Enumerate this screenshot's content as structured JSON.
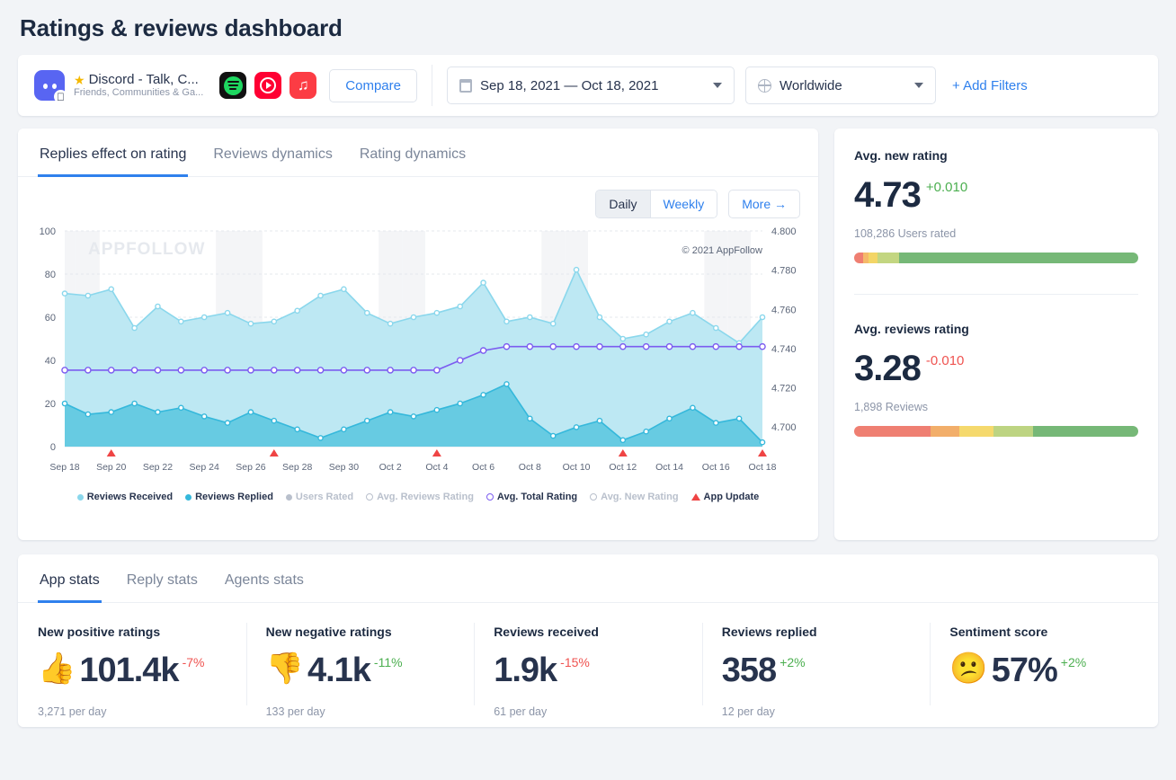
{
  "page_title": "Ratings & reviews dashboard",
  "header": {
    "app": {
      "name": "Discord - Talk, C...",
      "subtitle": "Friends, Communities & Ga...",
      "star_icon": "★",
      "platform_badge": "apple-icon"
    },
    "store_icons": [
      "spotify-icon",
      "youtube-music-icon",
      "apple-music-icon"
    ],
    "compare_label": "Compare",
    "date_range": "Sep 18, 2021 — Oct 18, 2021",
    "geo": "Worldwide",
    "add_filters_label": "+ Add Filters"
  },
  "chart_panel": {
    "tabs": [
      {
        "label": "Replies effect on rating",
        "active": true
      },
      {
        "label": "Reviews dynamics",
        "active": false
      },
      {
        "label": "Rating dynamics",
        "active": false
      }
    ],
    "granularity": [
      {
        "label": "Daily",
        "selected": true
      },
      {
        "label": "Weekly",
        "selected": false
      }
    ],
    "more_label": "More →",
    "watermark": "APPFOLLOW",
    "copyright": "© 2021 AppFollow"
  },
  "chart_data": {
    "type": "area",
    "title": "Replies effect on rating",
    "xlabel": "",
    "ylabel": "",
    "grid": true,
    "legend_position": "bottom",
    "x": [
      "Sep 18",
      "Sep 19",
      "Sep 20",
      "Sep 21",
      "Sep 22",
      "Sep 23",
      "Sep 24",
      "Sep 25",
      "Sep 26",
      "Sep 27",
      "Sep 28",
      "Sep 29",
      "Sep 30",
      "Oct 1",
      "Oct 2",
      "Oct 3",
      "Oct 4",
      "Oct 5",
      "Oct 6",
      "Oct 7",
      "Oct 8",
      "Oct 9",
      "Oct 10",
      "Oct 11",
      "Oct 12",
      "Oct 13",
      "Oct 14",
      "Oct 15",
      "Oct 16",
      "Oct 17",
      "Oct 18"
    ],
    "tick_labels_x": [
      "Sep 18",
      "Sep 20",
      "Sep 22",
      "Sep 24",
      "Sep 26",
      "Sep 28",
      "Sep 30",
      "Oct 2",
      "Oct 4",
      "Oct 6",
      "Oct 8",
      "Oct 10",
      "Oct 12",
      "Oct 14",
      "Oct 16",
      "Oct 18"
    ],
    "ylim_left": [
      0,
      100
    ],
    "ticks_left": [
      0,
      20,
      40,
      60,
      80,
      100
    ],
    "ylim_right": [
      4.69,
      4.8
    ],
    "ticks_right": [
      "4.700",
      "4.720",
      "4.740",
      "4.760",
      "4.780",
      "4.800"
    ],
    "series": [
      {
        "name": "Reviews Received",
        "axis": "left",
        "color": "#a5dfee",
        "type": "area",
        "visible": true,
        "values": [
          71,
          70,
          73,
          55,
          65,
          58,
          60,
          62,
          57,
          58,
          63,
          70,
          73,
          62,
          57,
          60,
          62,
          65,
          76,
          58,
          60,
          57,
          82,
          60,
          50,
          52,
          58,
          62,
          55,
          48,
          60
        ]
      },
      {
        "name": "Reviews Replied",
        "axis": "left",
        "color": "#4ec3dd",
        "type": "area",
        "visible": true,
        "values": [
          20,
          15,
          16,
          20,
          16,
          18,
          14,
          11,
          16,
          12,
          8,
          4,
          8,
          12,
          16,
          14,
          17,
          20,
          24,
          29,
          13,
          5,
          9,
          12,
          3,
          7,
          13,
          18,
          11,
          13,
          2
        ]
      },
      {
        "name": "Users Rated",
        "axis": "left",
        "color": "#b9c0cc",
        "type": "line",
        "visible": false,
        "values": []
      },
      {
        "name": "Avg. Reviews Rating",
        "axis": "right",
        "color": "#b9c0cc",
        "type": "line",
        "visible": false,
        "values": []
      },
      {
        "name": "Avg. Total Rating",
        "axis": "right",
        "color": "#7c5cf0",
        "type": "line",
        "visible": true,
        "values": [
          4.729,
          4.729,
          4.729,
          4.729,
          4.729,
          4.729,
          4.729,
          4.729,
          4.729,
          4.729,
          4.729,
          4.729,
          4.729,
          4.729,
          4.729,
          4.729,
          4.729,
          4.734,
          4.739,
          4.741,
          4.741,
          4.741,
          4.741,
          4.741,
          4.741,
          4.741,
          4.741,
          4.741,
          4.741,
          4.741,
          4.741
        ]
      },
      {
        "name": "Avg. New Rating",
        "axis": "right",
        "color": "#b9c0cc",
        "type": "line",
        "visible": false,
        "values": []
      },
      {
        "name": "App Update",
        "axis": "left",
        "color": "#ef4444",
        "type": "marker",
        "visible": true,
        "markers": [
          "Sep 20",
          "Sep 27",
          "Oct 4",
          "Oct 12",
          "Oct 18"
        ]
      }
    ]
  },
  "side_metrics": [
    {
      "title": "Avg. new rating",
      "value": "4.73",
      "delta": "+0.010",
      "delta_dir": "up",
      "sub": "108,286 Users rated",
      "distribution": [
        {
          "color": "#ef7f72",
          "pct": 3.2
        },
        {
          "color": "#f5b96a",
          "pct": 2.0
        },
        {
          "color": "#f3d566",
          "pct": 3.0
        },
        {
          "color": "#c3d681",
          "pct": 7.6
        },
        {
          "color": "#76b877",
          "pct": 84.2
        }
      ]
    },
    {
      "title": "Avg. reviews rating",
      "value": "3.28",
      "delta": "-0.010",
      "delta_dir": "down",
      "sub": "1,898 Reviews",
      "distribution": [
        {
          "color": "#ef7f72",
          "pct": 27.0
        },
        {
          "color": "#f2ae6a",
          "pct": 10.0
        },
        {
          "color": "#f5d96d",
          "pct": 12.0
        },
        {
          "color": "#bdd482",
          "pct": 14.0
        },
        {
          "color": "#76b877",
          "pct": 37.0
        }
      ]
    }
  ],
  "bottom_panel": {
    "tabs": [
      {
        "label": "App stats",
        "active": true
      },
      {
        "label": "Reply stats",
        "active": false
      },
      {
        "label": "Agents stats",
        "active": false
      }
    ],
    "stats": [
      {
        "label": "New positive ratings",
        "emoji": "👍",
        "value": "101.4k",
        "delta": "-7%",
        "delta_dir": "down",
        "sub": "3,271 per day"
      },
      {
        "label": "New negative ratings",
        "emoji": "👎",
        "value": "4.1k",
        "delta": "-11%",
        "delta_dir": "up",
        "sub": "133 per day"
      },
      {
        "label": "Reviews received",
        "emoji": "",
        "value": "1.9k",
        "delta": "-15%",
        "delta_dir": "down",
        "sub": "61 per day"
      },
      {
        "label": "Reviews replied",
        "emoji": "",
        "value": "358",
        "delta": "+2%",
        "delta_dir": "up",
        "sub": "12 per day"
      },
      {
        "label": "Sentiment score",
        "emoji": "😕",
        "value": "57%",
        "delta": "+2%",
        "delta_dir": "up",
        "sub": ""
      }
    ]
  }
}
